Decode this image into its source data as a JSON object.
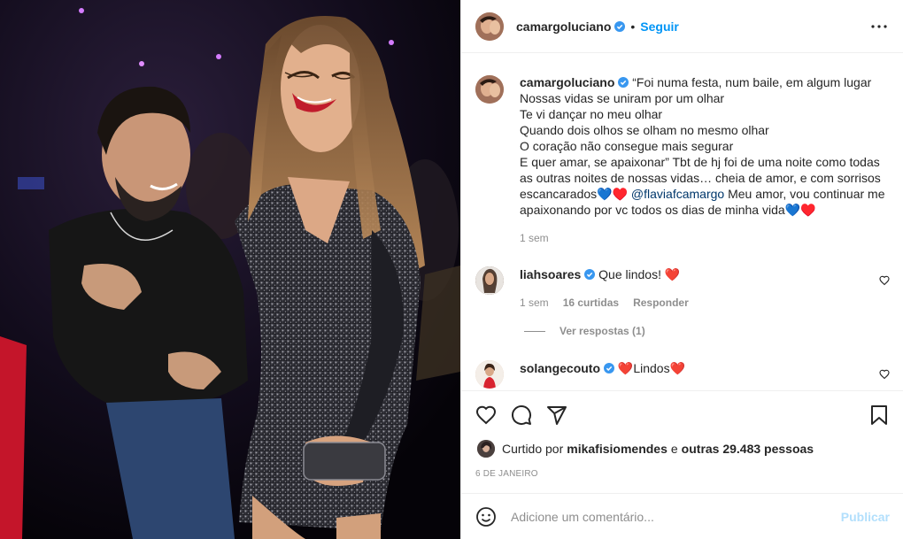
{
  "post": {
    "image_alt": "Foto do casal numa festa"
  },
  "header": {
    "username": "camargoluciano",
    "separator": "•",
    "follow_label": "Seguir"
  },
  "caption": {
    "username": "camargoluciano",
    "text": "“Foi numa festa, num baile, em algum lugar\nNossas vidas se uniram por um olhar\nTe vi dançar no meu olhar\nQuando dois olhos se olham no mesmo olhar\nO coração não consegue mais segurar\nE quer amar, se apaixonar” Tbt de hj foi de uma noite como todas\nas outras noites de nossas vidas… cheia de amor, e com sorrisos\nescancarados💙♥️ ",
    "mention": "@flaviafcamargo",
    "text_after": " Meu amor, vou continuar me\napaixonando por vc todos os dias de minha vida💙♥️",
    "time": "1 sem"
  },
  "comments": [
    {
      "username": "liahsoares",
      "text": "Que lindos! ❤️",
      "time": "1 sem",
      "likes": "16 curtidas",
      "reply_label": "Responder",
      "view_replies": "Ver respostas (1)"
    },
    {
      "username": "solangecouto",
      "text": "❤️Lindos❤️"
    }
  ],
  "likes": {
    "prefix": "Curtido por ",
    "user": "mikafisiomendes",
    "middle": " e ",
    "others": "outras 29.483 pessoas"
  },
  "date": "6 DE JANEIRO",
  "add_comment": {
    "placeholder": "Adicione um comentário...",
    "publish_label": "Publicar"
  },
  "colors": {
    "accent": "#0095f6",
    "publish_disabled": "#b2dffc",
    "muted": "#8e8e8e",
    "text": "#262626",
    "heart_red": "#ed4956"
  },
  "icons": {
    "verified": "verified-badge-icon",
    "more": "more-options-icon",
    "like": "heart-icon",
    "comment": "comment-icon",
    "share": "send-icon",
    "save": "bookmark-icon",
    "emoji": "emoji-icon"
  }
}
